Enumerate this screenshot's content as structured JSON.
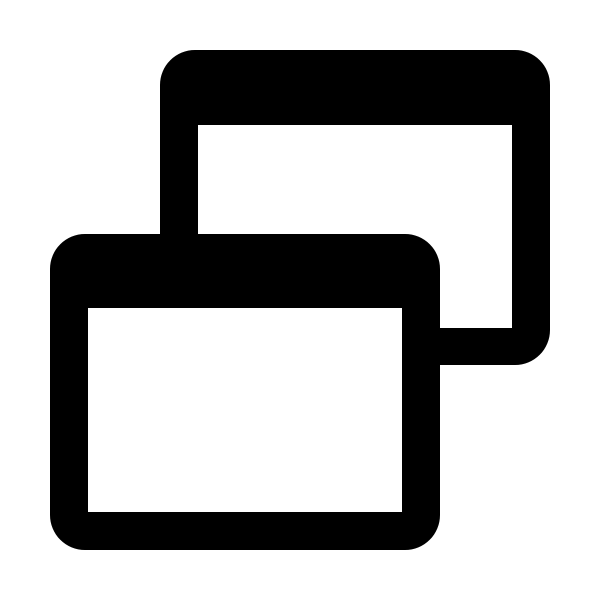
{
  "icon": {
    "name": "multiple-windows-icon",
    "color": "#000000",
    "background": "#ffffff"
  }
}
